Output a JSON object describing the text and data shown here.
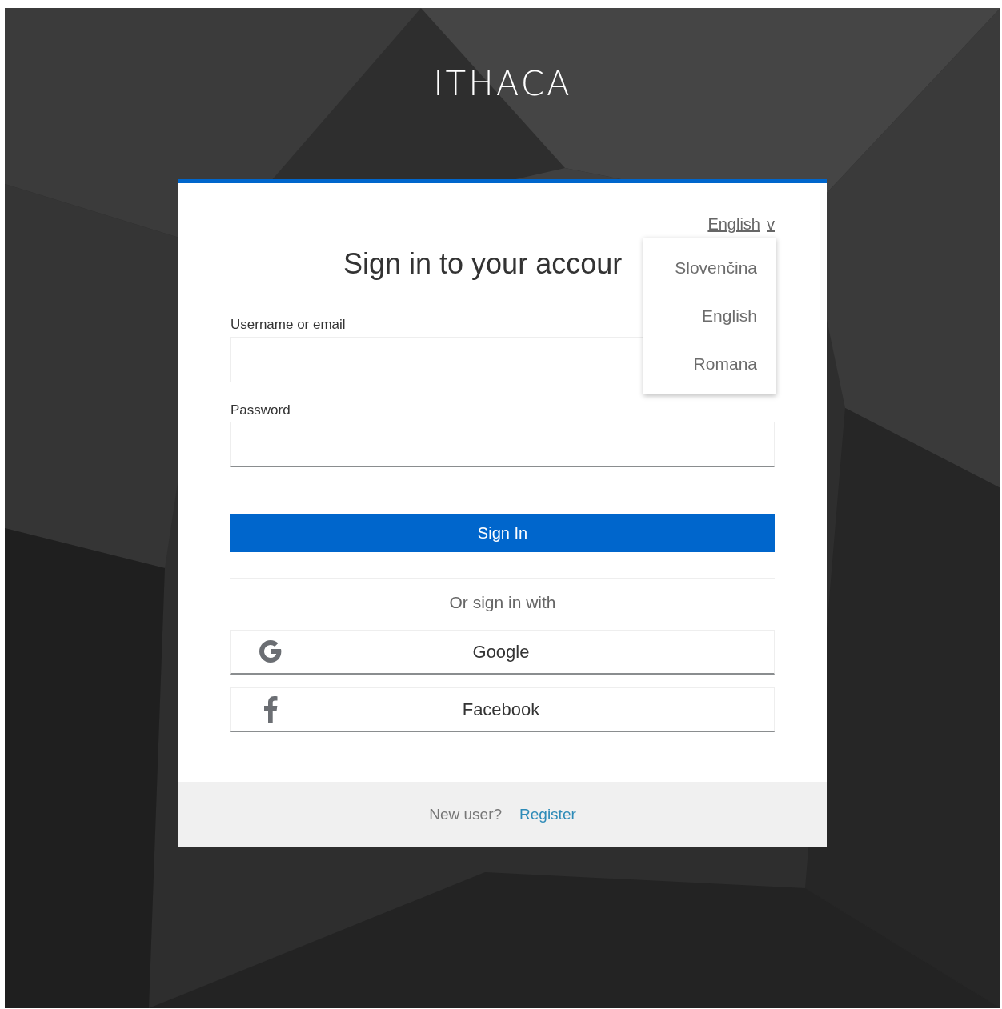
{
  "brand": "ITHACA",
  "language": {
    "current": "English",
    "caret": "v",
    "expanded": true,
    "options": [
      {
        "label": "Slovenčina"
      },
      {
        "label": "English"
      },
      {
        "label": "Romana"
      }
    ]
  },
  "heading": "Sign in to your accour",
  "fields": [
    {
      "label": "Username or email"
    },
    {
      "label": "Password"
    }
  ],
  "submit": "Sign In",
  "divider_text": "Or sign in with",
  "providers": [
    {
      "kind": "google",
      "label": "Google"
    },
    {
      "kind": "facebook",
      "label": "Facebook"
    }
  ],
  "footer": {
    "prompt": "New user?",
    "link": "Register"
  }
}
